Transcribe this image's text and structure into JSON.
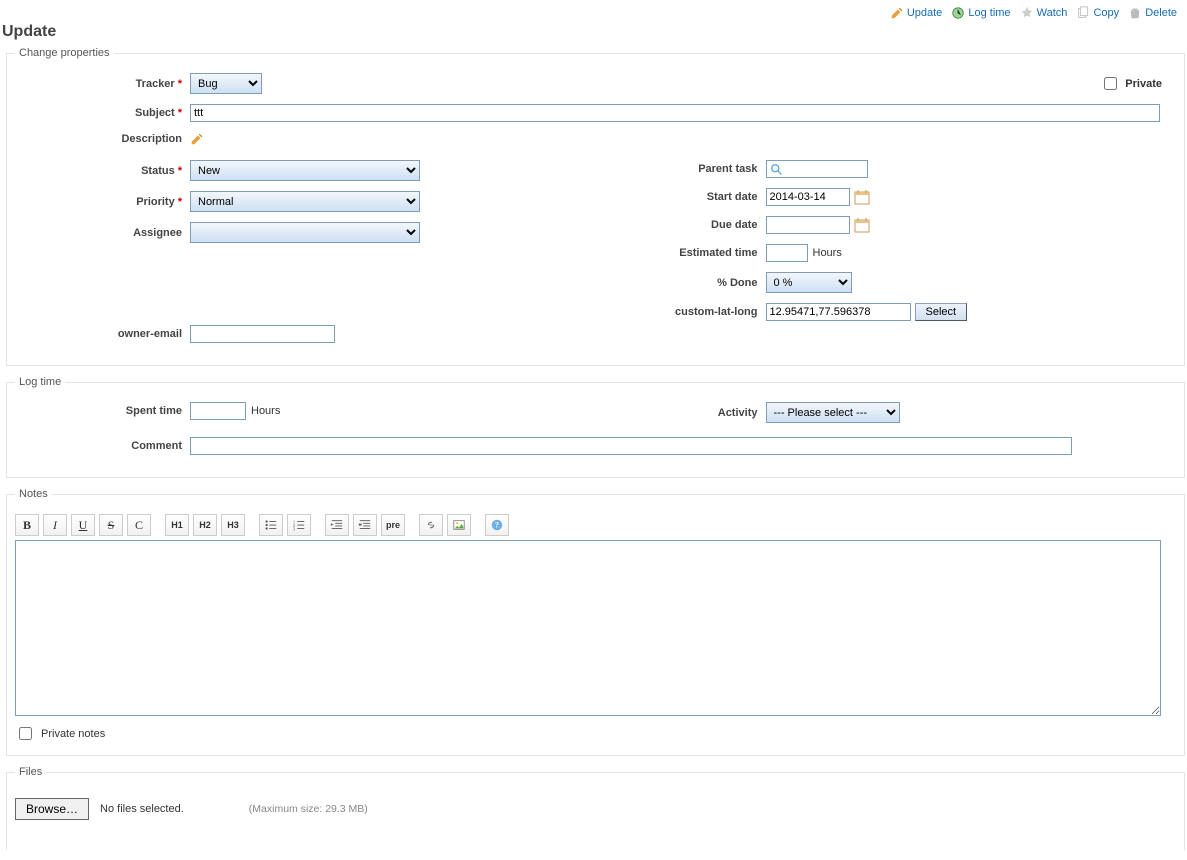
{
  "contextual": {
    "update": "Update",
    "log_time": "Log time",
    "watch": "Watch",
    "copy": "Copy",
    "delete": "Delete"
  },
  "title": "Update",
  "legend": {
    "change_properties": "Change properties",
    "log_time": "Log time",
    "notes": "Notes",
    "files": "Files"
  },
  "labels": {
    "tracker": "Tracker",
    "private": "Private",
    "subject": "Subject",
    "description": "Description",
    "status": "Status",
    "priority": "Priority",
    "assignee": "Assignee",
    "owner_email": "owner-email",
    "parent_task": "Parent task",
    "start_date": "Start date",
    "due_date": "Due date",
    "estimated_time": "Estimated time",
    "pct_done": "% Done",
    "custom_lat_long": "custom-lat-long",
    "spent_time": "Spent time",
    "activity": "Activity",
    "comment": "Comment",
    "hours": "Hours",
    "private_notes": "Private notes",
    "no_files": "No files selected.",
    "max_size": "(Maximum size: 29.3 MB)",
    "browse": "Browse…",
    "select": "Select",
    "req": "*"
  },
  "values": {
    "tracker": "Bug",
    "subject": "ttt",
    "status": "New",
    "priority": "Normal",
    "assignee": "",
    "owner_email": "",
    "parent_task": "",
    "start_date": "2014-03-14",
    "due_date": "",
    "estimated_time": "",
    "pct_done": "0 %",
    "custom_lat_long": "12.95471,77.596378",
    "spent_time": "",
    "activity": "--- Please select ---",
    "comment": ""
  },
  "toolbar": {
    "b": "B",
    "i": "I",
    "u": "U",
    "s": "S",
    "c": "C",
    "h1": "H1",
    "h2": "H2",
    "h3": "H3",
    "pre": "pre"
  }
}
